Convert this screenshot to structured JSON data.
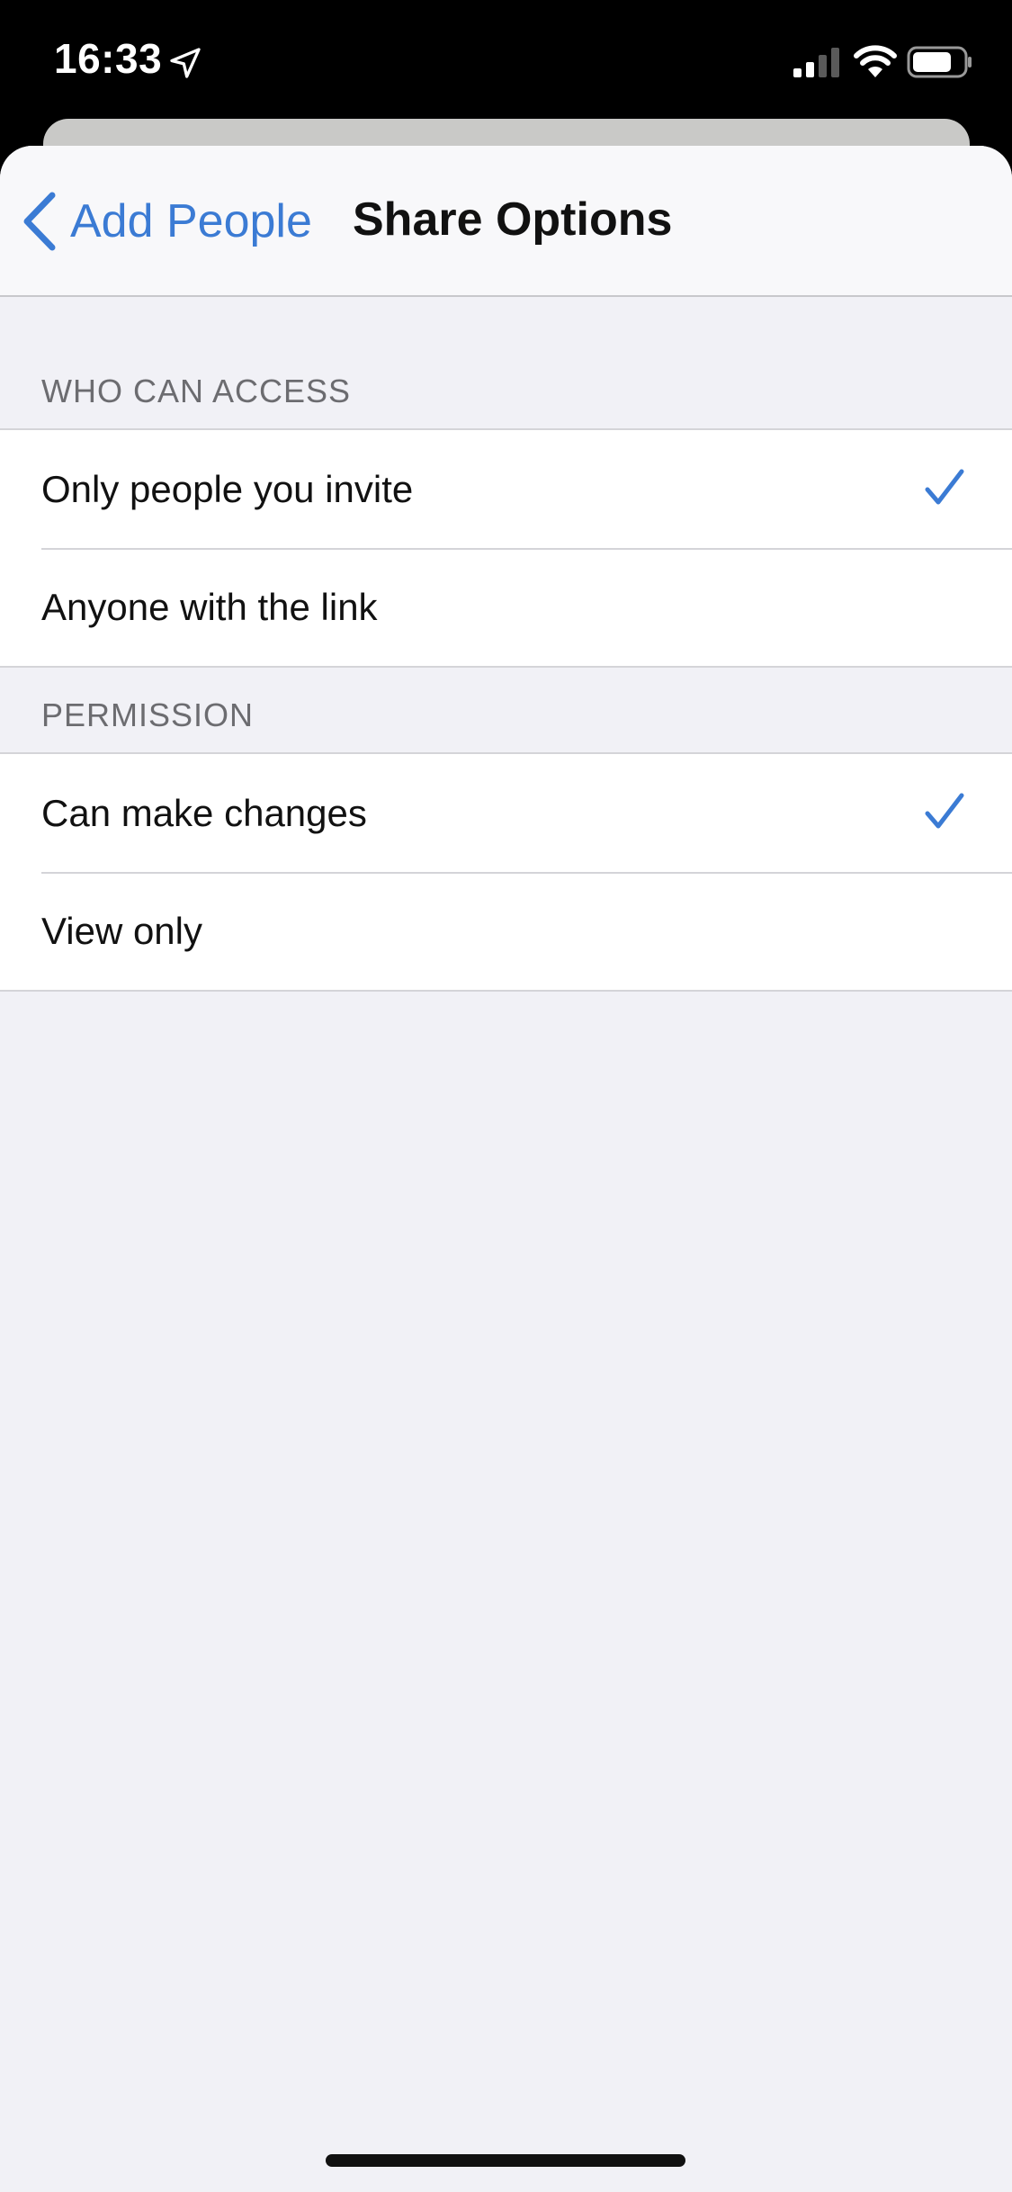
{
  "status_bar": {
    "time": "16:33",
    "icons": [
      "location-arrow-icon",
      "cellular-signal-icon",
      "wifi-icon",
      "battery-icon"
    ]
  },
  "nav": {
    "back_label": "Add People",
    "back_icon": "chevron-left-icon",
    "title": "Share Options"
  },
  "sections": [
    {
      "header": "WHO CAN ACCESS",
      "options": [
        {
          "label": "Only people you invite",
          "selected": true
        },
        {
          "label": "Anyone with the link",
          "selected": false
        }
      ]
    },
    {
      "header": "PERMISSION",
      "options": [
        {
          "label": "Can make changes",
          "selected": true
        },
        {
          "label": "View only",
          "selected": false
        }
      ]
    }
  ],
  "colors": {
    "accent": "#3b7bd4",
    "background": "#f1f1f6",
    "row_background": "#ffffff",
    "separator": "#d4d4d8",
    "section_header": "#6c6c70"
  }
}
